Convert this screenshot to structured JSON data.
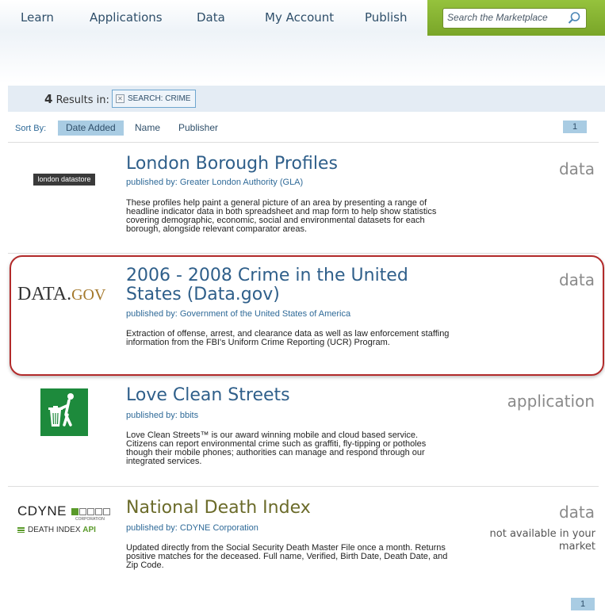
{
  "nav": {
    "items": [
      "Learn",
      "Applications",
      "Data",
      "My Account",
      "Publish"
    ],
    "search_placeholder": "Search the Marketplace"
  },
  "results": {
    "count": "4",
    "label": "Results in:",
    "filter_tag": "SEARCH: CRIME"
  },
  "sort": {
    "label": "Sort By:",
    "options": [
      "Date Added",
      "Name",
      "Publisher"
    ],
    "active": "Date Added",
    "page": "1"
  },
  "items": [
    {
      "logo": "london datastore",
      "title": "London Borough Profiles",
      "publisher": "published by: Greater London Authority (GLA)",
      "description": "These profiles help paint a general picture of an area by presenting a range of headline indicator data in both spreadsheet and map form to help show statistics covering demographic, economic, social and environmental datasets for each borough, alongside relevant comparator areas.",
      "type": "data"
    },
    {
      "logo_main": "DATA.",
      "logo_accent": "GOV",
      "title": "2006 - 2008 Crime in the United States (Data.gov)",
      "publisher": "published by: Government of the United States of America",
      "description": "Extraction of offense, arrest, and clearance data as well as law enforcement staffing information from the FBI's Uniform Crime Reporting (UCR) Program.",
      "type": "data"
    },
    {
      "title": "Love Clean Streets",
      "publisher": "published by: bbits",
      "description": "Love Clean Streets™ is our award winning mobile and cloud based service. Citizens can report environmental crime such as graffiti, fly-tipping or potholes though their mobile phones; authorities can manage and respond through our integrated services.",
      "type": "application"
    },
    {
      "logo_word": "CDYNE",
      "logo_corp": "CORPORATION",
      "logo_sub": "DEATH INDEX",
      "logo_api": "API",
      "title": "National Death Index",
      "publisher": "published by: CDYNE Corporation",
      "description": "Updated directly from the Social Security Death Master File once a month. Returns positive matches for the deceased. Full name, Verified, Birth Date, Death Date, and Zip Code.",
      "type": "data",
      "availability": "not available in your market"
    }
  ],
  "footer_page": "1",
  "colors": {
    "accent_green": "#86b232",
    "link_blue": "#2f5f8a",
    "highlight_red": "#b22a2a",
    "sort_active": "#a9cce3"
  }
}
